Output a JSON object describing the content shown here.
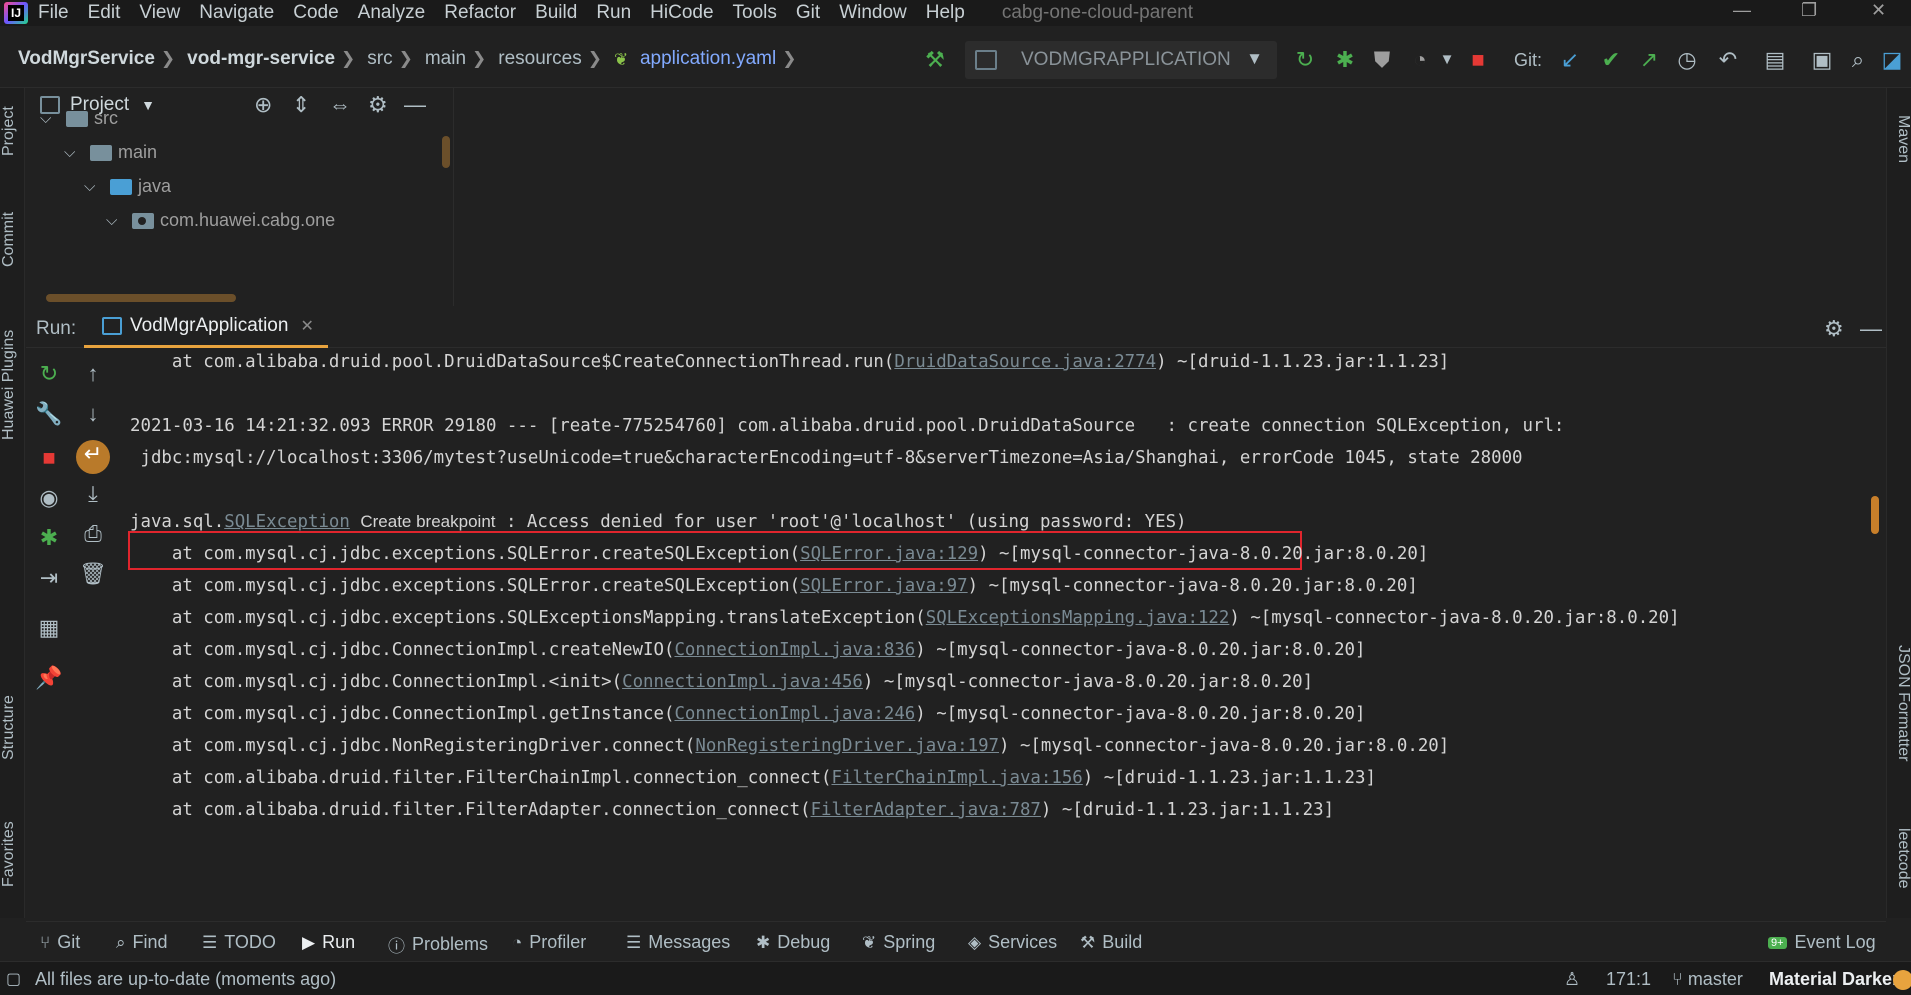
{
  "menubar": {
    "items": [
      "File",
      "Edit",
      "View",
      "Navigate",
      "Code",
      "Analyze",
      "Refactor",
      "Build",
      "Run",
      "HiCode",
      "Tools",
      "Git",
      "Window",
      "Help"
    ],
    "project_name": "cabg-one-cloud-parent"
  },
  "breadcrumb": {
    "items": [
      "VodMgrService",
      "vod-mgr-service",
      "src",
      "main",
      "resources",
      "application.yaml"
    ]
  },
  "toolbar": {
    "run_config": "VODMGRAPPLICATION",
    "git_label": "Git:"
  },
  "left_strip": {
    "tabs": [
      "Project",
      "Commit",
      "Huawei Plugins",
      "Structure",
      "Favorites"
    ]
  },
  "right_strip": {
    "tabs": [
      "Maven",
      "JSON Formatter",
      "leetcode"
    ]
  },
  "project_panel": {
    "title": "Project",
    "tree": [
      "src",
      "main",
      "java",
      "com.huawei.cabg.one"
    ]
  },
  "run_panel": {
    "label": "Run:",
    "tab": "VodMgrApplication"
  },
  "console": {
    "line0_pre": "    at com.alibaba.druid.pool.DruidDataSource$CreateConnectionThread.run(",
    "line0_link": "DruidDataSource.java:2774",
    "line0_post": ") ~[druid-1.1.23.jar:1.1.23]",
    "line1": "2021-03-16 14:21:32.093 ERROR 29180 --- [reate-775254760] com.alibaba.druid.pool.DruidDataSource   : create connection SQLException, url:",
    "line2": " jdbc:mysql://localhost:3306/mytest?useUnicode=true&characterEncoding=utf-8&serverTimezone=Asia/Shanghai, errorCode 1045, state 28000",
    "err_prefix": "java.sql.",
    "err_link": "SQLException",
    "err_breakpoint": "Create breakpoint",
    "err_message": " : Access denied for user 'root'@'localhost' (using password: YES)",
    "stack": [
      {
        "pre": "    at com.mysql.cj.jdbc.exceptions.SQLError.createSQLException(",
        "link": "SQLError.java:129",
        "post": ") ~[mysql-connector-java-8.0.20.jar:8.0.20]"
      },
      {
        "pre": "    at com.mysql.cj.jdbc.exceptions.SQLError.createSQLException(",
        "link": "SQLError.java:97",
        "post": ") ~[mysql-connector-java-8.0.20.jar:8.0.20]"
      },
      {
        "pre": "    at com.mysql.cj.jdbc.exceptions.SQLExceptionsMapping.translateException(",
        "link": "SQLExceptionsMapping.java:122",
        "post": ") ~[mysql-connector-java-8.0.20.jar:8.0.20]"
      },
      {
        "pre": "    at com.mysql.cj.jdbc.ConnectionImpl.createNewIO(",
        "link": "ConnectionImpl.java:836",
        "post": ") ~[mysql-connector-java-8.0.20.jar:8.0.20]"
      },
      {
        "pre": "    at com.mysql.cj.jdbc.ConnectionImpl.<init>(",
        "link": "ConnectionImpl.java:456",
        "post": ") ~[mysql-connector-java-8.0.20.jar:8.0.20]"
      },
      {
        "pre": "    at com.mysql.cj.jdbc.ConnectionImpl.getInstance(",
        "link": "ConnectionImpl.java:246",
        "post": ") ~[mysql-connector-java-8.0.20.jar:8.0.20]"
      },
      {
        "pre": "    at com.mysql.cj.jdbc.NonRegisteringDriver.connect(",
        "link": "NonRegisteringDriver.java:197",
        "post": ") ~[mysql-connector-java-8.0.20.jar:8.0.20]"
      },
      {
        "pre": "    at com.alibaba.druid.filter.FilterChainImpl.connection_connect(",
        "link": "FilterChainImpl.java:156",
        "post": ") ~[druid-1.1.23.jar:1.1.23]"
      },
      {
        "pre": "    at com.alibaba.druid.filter.FilterAdapter.connection_connect(",
        "link": "FilterAdapter.java:787",
        "post": ") ~[druid-1.1.23.jar:1.1.23]"
      }
    ]
  },
  "bottom_tabs": [
    "Git",
    "Find",
    "TODO",
    "Run",
    "Problems",
    "Profiler",
    "Messages",
    "Debug",
    "Spring",
    "Services",
    "Build"
  ],
  "event_log": {
    "badge": "9+",
    "label": "Event Log"
  },
  "statusbar": {
    "message": "All files are up-to-date (moments ago)",
    "position": "171:1",
    "branch": "master",
    "theme": "Material Darker"
  },
  "colors": {
    "accent": "#e8a33e",
    "error_box": "#e0252d",
    "run_green": "#4caf50",
    "stop_red": "#e53935",
    "link": "#7a8a93"
  }
}
